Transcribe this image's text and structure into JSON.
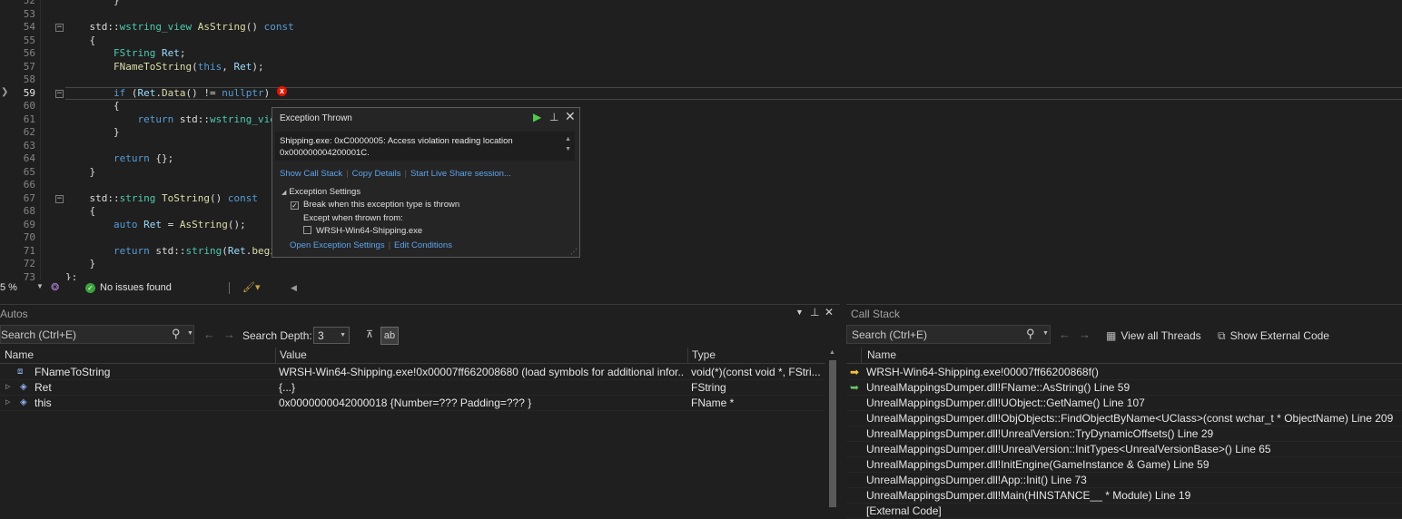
{
  "editor": {
    "lines": [
      {
        "num": "52",
        "tokens": [
          {
            "t": "        }",
            "c": "pl"
          }
        ]
      },
      {
        "num": "53",
        "tokens": []
      },
      {
        "num": "54",
        "tokens": [
          {
            "t": "    std::",
            "c": "pl"
          },
          {
            "t": "wstring_view",
            "c": "ty"
          },
          {
            "t": " ",
            "c": "pl"
          },
          {
            "t": "AsString",
            "c": "fn"
          },
          {
            "t": "() ",
            "c": "pl"
          },
          {
            "t": "const",
            "c": "kw"
          }
        ],
        "fold": "-"
      },
      {
        "num": "55",
        "tokens": [
          {
            "t": "    {",
            "c": "pl"
          }
        ]
      },
      {
        "num": "56",
        "tokens": [
          {
            "t": "        ",
            "c": "pl"
          },
          {
            "t": "FString",
            "c": "ty"
          },
          {
            "t": " ",
            "c": "pl"
          },
          {
            "t": "Ret",
            "c": "va"
          },
          {
            "t": ";",
            "c": "pl"
          }
        ]
      },
      {
        "num": "57",
        "tokens": [
          {
            "t": "        ",
            "c": "pl"
          },
          {
            "t": "FNameToString",
            "c": "fn"
          },
          {
            "t": "(",
            "c": "pl"
          },
          {
            "t": "this",
            "c": "kw"
          },
          {
            "t": ", ",
            "c": "pl"
          },
          {
            "t": "Ret",
            "c": "va"
          },
          {
            "t": ");",
            "c": "pl"
          }
        ]
      },
      {
        "num": "58",
        "tokens": []
      },
      {
        "num": "59",
        "tokens": [
          {
            "t": "        ",
            "c": "pl"
          },
          {
            "t": "if",
            "c": "kw"
          },
          {
            "t": " (",
            "c": "pl"
          },
          {
            "t": "Ret",
            "c": "va"
          },
          {
            "t": ".",
            "c": "pl"
          },
          {
            "t": "Data",
            "c": "fn"
          },
          {
            "t": "() != ",
            "c": "pl"
          },
          {
            "t": "nullptr",
            "c": "kw"
          },
          {
            "t": ")",
            "c": "pl"
          }
        ],
        "fold": "-",
        "current": true
      },
      {
        "num": "60",
        "tokens": [
          {
            "t": "        {",
            "c": "pl"
          }
        ]
      },
      {
        "num": "61",
        "tokens": [
          {
            "t": "            ",
            "c": "pl"
          },
          {
            "t": "return",
            "c": "kw"
          },
          {
            "t": " std::",
            "c": "pl"
          },
          {
            "t": "wstring_vie",
            "c": "ty"
          }
        ]
      },
      {
        "num": "62",
        "tokens": [
          {
            "t": "        }",
            "c": "pl"
          }
        ]
      },
      {
        "num": "63",
        "tokens": []
      },
      {
        "num": "64",
        "tokens": [
          {
            "t": "        ",
            "c": "pl"
          },
          {
            "t": "return",
            "c": "kw"
          },
          {
            "t": " {};",
            "c": "pl"
          }
        ]
      },
      {
        "num": "65",
        "tokens": [
          {
            "t": "    }",
            "c": "pl"
          }
        ]
      },
      {
        "num": "66",
        "tokens": []
      },
      {
        "num": "67",
        "tokens": [
          {
            "t": "    std::",
            "c": "pl"
          },
          {
            "t": "string",
            "c": "ty"
          },
          {
            "t": " ",
            "c": "pl"
          },
          {
            "t": "ToString",
            "c": "fn"
          },
          {
            "t": "() ",
            "c": "pl"
          },
          {
            "t": "const",
            "c": "kw"
          }
        ],
        "fold": "-"
      },
      {
        "num": "68",
        "tokens": [
          {
            "t": "    {",
            "c": "pl"
          }
        ]
      },
      {
        "num": "69",
        "tokens": [
          {
            "t": "        ",
            "c": "pl"
          },
          {
            "t": "auto",
            "c": "kw"
          },
          {
            "t": " ",
            "c": "pl"
          },
          {
            "t": "Ret",
            "c": "va"
          },
          {
            "t": " = ",
            "c": "pl"
          },
          {
            "t": "AsString",
            "c": "fn"
          },
          {
            "t": "();",
            "c": "pl"
          }
        ]
      },
      {
        "num": "70",
        "tokens": []
      },
      {
        "num": "71",
        "tokens": [
          {
            "t": "        ",
            "c": "pl"
          },
          {
            "t": "return",
            "c": "kw"
          },
          {
            "t": " std::",
            "c": "pl"
          },
          {
            "t": "string",
            "c": "ty"
          },
          {
            "t": "(",
            "c": "pl"
          },
          {
            "t": "Ret",
            "c": "va"
          },
          {
            "t": ".",
            "c": "pl"
          },
          {
            "t": "begi",
            "c": "fn"
          }
        ]
      },
      {
        "num": "72",
        "tokens": [
          {
            "t": "    }",
            "c": "pl"
          }
        ]
      },
      {
        "num": "73",
        "tokens": [
          {
            "t": "};",
            "c": "pl"
          }
        ]
      }
    ]
  },
  "exception": {
    "title": "Exception Thrown",
    "message_line1": "Shipping.exe: 0xC0000005: Access violation reading location",
    "message_line2": "0x000000004200001C.",
    "link_call_stack": "Show Call Stack",
    "link_copy": "Copy Details",
    "link_live_share": "Start Live Share session...",
    "settings_header": "Exception Settings",
    "break_label": "Break when this exception type is thrown",
    "break_checked": true,
    "except_label": "Except when thrown from:",
    "module_label": "WRSH-Win64-Shipping.exe",
    "module_checked": false,
    "link_open_settings": "Open Exception Settings",
    "link_edit_conditions": "Edit Conditions"
  },
  "statusbar": {
    "zoom": "5 %",
    "issues": "No issues found"
  },
  "autos": {
    "title": "Autos",
    "search_placeholder": "Search (Ctrl+E)",
    "depth_label": "Search Depth:",
    "depth_value": "3",
    "columns": {
      "name": "Name",
      "value": "Value",
      "type": "Type"
    },
    "rows": [
      {
        "name": "FNameToString",
        "value": "WRSH-Win64-Shipping.exe!0x00007ff662008680 (load symbols for additional infor...",
        "type": "void(*)(const void *, FStri...",
        "expandable": false
      },
      {
        "name": "Ret",
        "value": "{...}",
        "type": "FString",
        "expandable": true
      },
      {
        "name": "this",
        "value": "0x0000000042000018 {Number=??? Padding=??? }",
        "type": "FName *",
        "expandable": true
      }
    ]
  },
  "callstack": {
    "title": "Call Stack",
    "search_placeholder": "Search (Ctrl+E)",
    "view_threads": "View all Threads",
    "show_external": "Show External Code",
    "column_name": "Name",
    "frames": [
      {
        "text": "WRSH-Win64-Shipping.exe!00007ff66200868f()",
        "marker": "current"
      },
      {
        "text": "UnrealMappingsDumper.dll!FName::AsString() Line 59",
        "marker": "return"
      },
      {
        "text": "UnrealMappingsDumper.dll!UObject::GetName() Line 107",
        "marker": ""
      },
      {
        "text": "UnrealMappingsDumper.dll!ObjObjects::FindObjectByName<UClass>(const wchar_t * ObjectName) Line 209",
        "marker": ""
      },
      {
        "text": "UnrealMappingsDumper.dll!UnrealVersion::TryDynamicOffsets() Line 29",
        "marker": ""
      },
      {
        "text": "UnrealMappingsDumper.dll!UnrealVersion::InitTypes<UnrealVersionBase>() Line 65",
        "marker": ""
      },
      {
        "text": "UnrealMappingsDumper.dll!InitEngine(GameInstance & Game) Line 59",
        "marker": ""
      },
      {
        "text": "UnrealMappingsDumper.dll!App::Init() Line 73",
        "marker": ""
      },
      {
        "text": "UnrealMappingsDumper.dll!Main(HINSTANCE__ * Module) Line 19",
        "marker": ""
      },
      {
        "text": "[External Code]",
        "marker": ""
      }
    ]
  },
  "colors": {
    "background": "#1f1f1f",
    "keyword": "#569cd6",
    "type": "#4ec9b0",
    "function": "#dcdcaa",
    "link": "#5ea3e8",
    "error": "#e51400"
  }
}
